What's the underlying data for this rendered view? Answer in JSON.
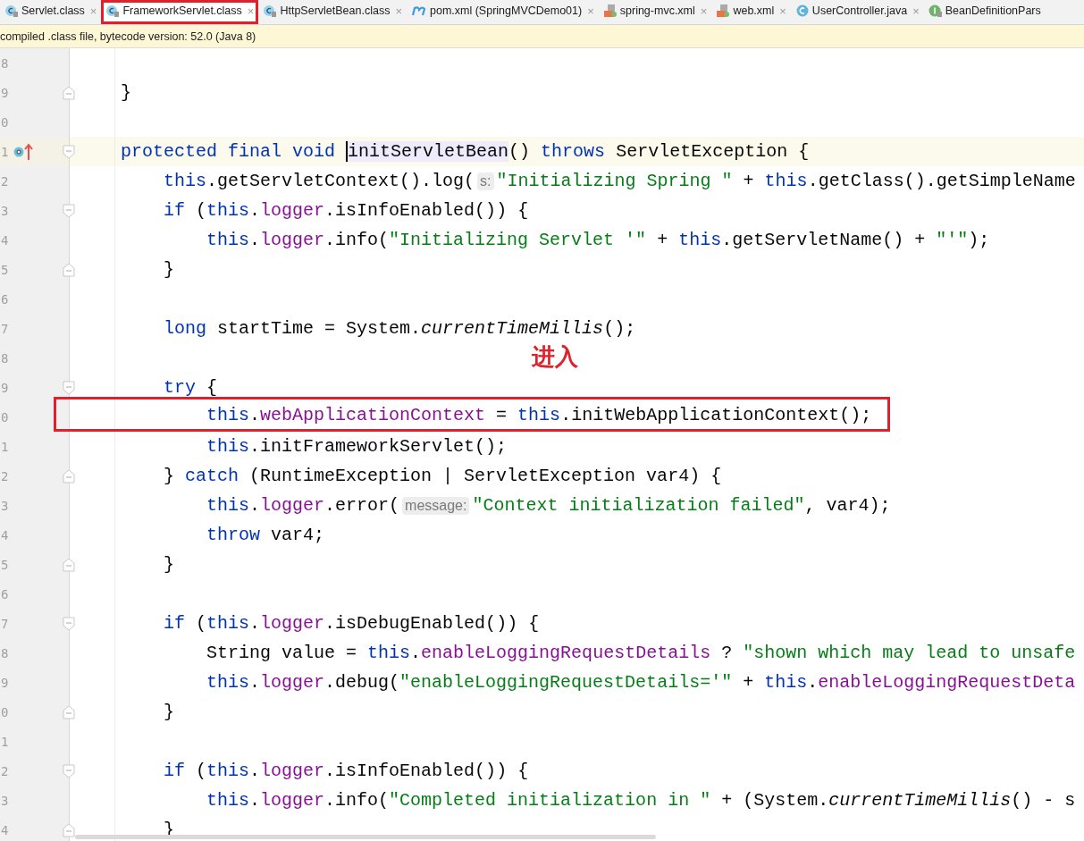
{
  "tabs": [
    {
      "label": "Servlet.class",
      "kind": "class",
      "close": "×",
      "selected": false,
      "boxed": false
    },
    {
      "label": "FrameworkServlet.class",
      "kind": "class",
      "close": "×",
      "selected": true,
      "boxed": true
    },
    {
      "label": "HttpServletBean.class",
      "kind": "class",
      "close": "×",
      "selected": false,
      "boxed": false
    },
    {
      "label": "pom.xml (SpringMVCDemo01)",
      "kind": "maven",
      "close": "×",
      "selected": false,
      "boxed": false
    },
    {
      "label": "spring-mvc.xml",
      "kind": "xml",
      "close": "×",
      "selected": false,
      "boxed": false
    },
    {
      "label": "web.xml",
      "kind": "xml",
      "close": "×",
      "selected": false,
      "boxed": false
    },
    {
      "label": "UserController.java",
      "kind": "java",
      "close": "×",
      "selected": false,
      "boxed": false
    },
    {
      "label": "BeanDefinitionPars",
      "kind": "interface",
      "selected": false,
      "boxed": false
    }
  ],
  "info_bar": "compiled .class file, bytecode version: 52.0 (Java 8)",
  "lines": [
    {
      "number": "8"
    },
    {
      "number": "9",
      "fold_end": true,
      "tokens": [
        {
          "kind": "plain",
          "text": "    }"
        }
      ]
    },
    {
      "number": "0"
    },
    {
      "number": "1",
      "current": true,
      "gutter_icons": true,
      "fold_start": true,
      "tokens": [
        {
          "kind": "kw",
          "text": "    protected final void "
        },
        {
          "kind": "usage",
          "caret": true,
          "text": "initServletBean"
        },
        {
          "kind": "plain",
          "text": "() "
        },
        {
          "kind": "kw",
          "text": "throws"
        },
        {
          "kind": "plain",
          "text": " ServletException {"
        }
      ]
    },
    {
      "number": "2",
      "tokens": [
        {
          "kind": "kw",
          "text": "        this"
        },
        {
          "kind": "plain",
          "text": ".getServletContext().log("
        },
        {
          "kind": "hint",
          "text": "s:"
        },
        {
          "kind": "str",
          "text": "\"Initializing Spring \""
        },
        {
          "kind": "plain",
          "text": " + "
        },
        {
          "kind": "kw",
          "text": "this"
        },
        {
          "kind": "plain",
          "text": ".getClass().getSimpleName"
        }
      ]
    },
    {
      "number": "3",
      "fold_start": true,
      "tokens": [
        {
          "kind": "kw",
          "text": "        if"
        },
        {
          "kind": "plain",
          "text": " ("
        },
        {
          "kind": "kw",
          "text": "this"
        },
        {
          "kind": "plain",
          "text": "."
        },
        {
          "kind": "field",
          "text": "logger"
        },
        {
          "kind": "plain",
          "text": ".isInfoEnabled()) {"
        }
      ]
    },
    {
      "number": "4",
      "tokens": [
        {
          "kind": "kw",
          "text": "            this"
        },
        {
          "kind": "plain",
          "text": "."
        },
        {
          "kind": "field",
          "text": "logger"
        },
        {
          "kind": "plain",
          "text": ".info("
        },
        {
          "kind": "str",
          "text": "\"Initializing Servlet '\""
        },
        {
          "kind": "plain",
          "text": " + "
        },
        {
          "kind": "kw",
          "text": "this"
        },
        {
          "kind": "plain",
          "text": ".getServletName() + "
        },
        {
          "kind": "str",
          "text": "\"'\""
        },
        {
          "kind": "plain",
          "text": ");"
        }
      ]
    },
    {
      "number": "5",
      "fold_end": true,
      "tokens": [
        {
          "kind": "plain",
          "text": "        }"
        }
      ]
    },
    {
      "number": "6"
    },
    {
      "number": "7",
      "tokens": [
        {
          "kind": "kw",
          "text": "        long"
        },
        {
          "kind": "plain",
          "text": " startTime = System."
        },
        {
          "kind": "static",
          "text": "currentTimeMillis"
        },
        {
          "kind": "plain",
          "text": "();"
        }
      ]
    },
    {
      "number": "8",
      "note": "进入"
    },
    {
      "number": "9",
      "fold_start": true,
      "tokens": [
        {
          "kind": "kw",
          "text": "        try"
        },
        {
          "kind": "plain",
          "text": " {"
        }
      ]
    },
    {
      "number": "0",
      "boxed": true,
      "tokens": [
        {
          "kind": "kw",
          "text": "            this"
        },
        {
          "kind": "plain",
          "text": "."
        },
        {
          "kind": "field",
          "text": "webApplicationContext"
        },
        {
          "kind": "plain",
          "text": " = "
        },
        {
          "kind": "kw",
          "text": "this"
        },
        {
          "kind": "plain",
          "text": ".initWebApplicationContext();"
        }
      ]
    },
    {
      "number": "1",
      "tokens": [
        {
          "kind": "kw",
          "text": "            this"
        },
        {
          "kind": "plain",
          "text": ".initFrameworkServlet();"
        }
      ]
    },
    {
      "number": "2",
      "fold_end": true,
      "tokens": [
        {
          "kind": "plain",
          "text": "        } "
        },
        {
          "kind": "kw",
          "text": "catch"
        },
        {
          "kind": "plain",
          "text": " (RuntimeException | ServletException var4) {"
        }
      ]
    },
    {
      "number": "3",
      "tokens": [
        {
          "kind": "kw",
          "text": "            this"
        },
        {
          "kind": "plain",
          "text": "."
        },
        {
          "kind": "field",
          "text": "logger"
        },
        {
          "kind": "plain",
          "text": ".error("
        },
        {
          "kind": "hint",
          "text": "message:"
        },
        {
          "kind": "str",
          "text": "\"Context initialization failed\""
        },
        {
          "kind": "plain",
          "text": ", var4);"
        }
      ]
    },
    {
      "number": "4",
      "tokens": [
        {
          "kind": "kw",
          "text": "            throw"
        },
        {
          "kind": "plain",
          "text": " var4;"
        }
      ]
    },
    {
      "number": "5",
      "fold_end": true,
      "tokens": [
        {
          "kind": "plain",
          "text": "        }"
        }
      ]
    },
    {
      "number": "6"
    },
    {
      "number": "7",
      "fold_start": true,
      "tokens": [
        {
          "kind": "kw",
          "text": "        if"
        },
        {
          "kind": "plain",
          "text": " ("
        },
        {
          "kind": "kw",
          "text": "this"
        },
        {
          "kind": "plain",
          "text": "."
        },
        {
          "kind": "field",
          "text": "logger"
        },
        {
          "kind": "plain",
          "text": ".isDebugEnabled()) {"
        }
      ]
    },
    {
      "number": "8",
      "tokens": [
        {
          "kind": "plain",
          "text": "            String value = "
        },
        {
          "kind": "kw",
          "text": "this"
        },
        {
          "kind": "plain",
          "text": "."
        },
        {
          "kind": "field",
          "text": "enableLoggingRequestDetails"
        },
        {
          "kind": "plain",
          "text": " ? "
        },
        {
          "kind": "str",
          "text": "\"shown which may lead to unsafe"
        }
      ]
    },
    {
      "number": "9",
      "tokens": [
        {
          "kind": "kw",
          "text": "            this"
        },
        {
          "kind": "plain",
          "text": "."
        },
        {
          "kind": "field",
          "text": "logger"
        },
        {
          "kind": "plain",
          "text": ".debug("
        },
        {
          "kind": "str",
          "text": "\"enableLoggingRequestDetails='\""
        },
        {
          "kind": "plain",
          "text": " + "
        },
        {
          "kind": "kw",
          "text": "this"
        },
        {
          "kind": "plain",
          "text": "."
        },
        {
          "kind": "field",
          "text": "enableLoggingRequestDeta"
        }
      ]
    },
    {
      "number": "0",
      "fold_end": true,
      "tokens": [
        {
          "kind": "plain",
          "text": "        }"
        }
      ]
    },
    {
      "number": "1"
    },
    {
      "number": "2",
      "fold_start": true,
      "tokens": [
        {
          "kind": "kw",
          "text": "        if"
        },
        {
          "kind": "plain",
          "text": " ("
        },
        {
          "kind": "kw",
          "text": "this"
        },
        {
          "kind": "plain",
          "text": "."
        },
        {
          "kind": "field",
          "text": "logger"
        },
        {
          "kind": "plain",
          "text": ".isInfoEnabled()) {"
        }
      ]
    },
    {
      "number": "3",
      "tokens": [
        {
          "kind": "kw",
          "text": "            this"
        },
        {
          "kind": "plain",
          "text": "."
        },
        {
          "kind": "field",
          "text": "logger"
        },
        {
          "kind": "plain",
          "text": ".info("
        },
        {
          "kind": "str",
          "text": "\"Completed initialization in \""
        },
        {
          "kind": "plain",
          "text": " + (System."
        },
        {
          "kind": "static",
          "text": "currentTimeMillis"
        },
        {
          "kind": "plain",
          "text": "() - s"
        }
      ]
    },
    {
      "number": "4",
      "fold_end": true,
      "tokens": [
        {
          "kind": "plain",
          "text": "        }"
        }
      ]
    }
  ]
}
